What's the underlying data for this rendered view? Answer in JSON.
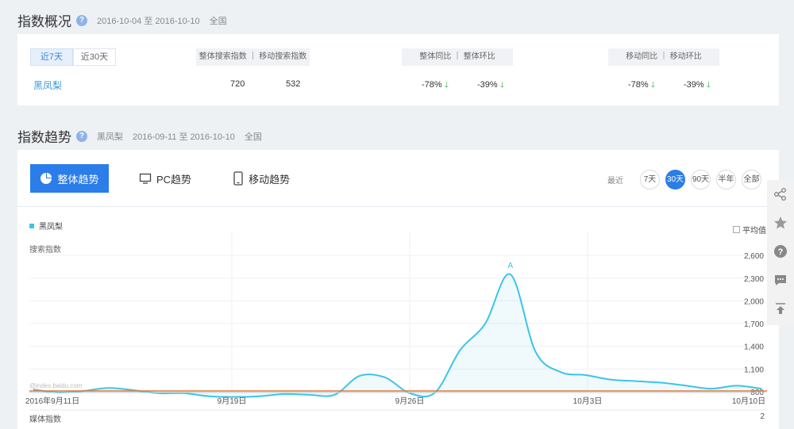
{
  "overview": {
    "title": "指数概况",
    "help": "?",
    "date_range": "2016-10-04 至 2016-10-10",
    "region": "全国",
    "tabs": [
      "近7天",
      "近30天"
    ],
    "keyword": "黑凤梨",
    "col_search": "整体搜索指数 ｜ 移动搜索指数",
    "col_overall": "整体同比 ｜ 整体环比",
    "col_mobile": "移动同比 ｜ 移动环比",
    "search_total": "720",
    "search_mobile": "532",
    "overall_yoy": "-78%",
    "overall_mom": "-39%",
    "mobile_yoy": "-78%",
    "mobile_mom": "-39%"
  },
  "trend": {
    "title": "指数趋势",
    "help": "?",
    "keyword": "黑凤梨",
    "date_range": "2016-09-11 至 2016-10-10",
    "region": "全国",
    "tabs": [
      "整体趋势",
      "PC趋势",
      "移动趋势"
    ],
    "period_label": "最近",
    "periods": [
      "7天",
      "30天",
      "90天",
      "半年",
      "全部"
    ],
    "legend": "黑凤梨",
    "avg_label": "平均值",
    "y_label": "搜索指数",
    "media_label": "媒体指数",
    "media_value": "2",
    "watermark": "@index.baidu.com"
  },
  "chart_data": {
    "type": "area",
    "ylabel": "搜索指数",
    "ylim": [
      800,
      2800
    ],
    "yticks": [
      "2,600",
      "2,300",
      "2,000",
      "1,700",
      "1,400",
      "1,100",
      "800"
    ],
    "ytick_values": [
      2600,
      2300,
      2000,
      1700,
      1400,
      1100,
      800
    ],
    "xticks": [
      "2016年9月11日",
      "9月19日",
      "9月26日",
      "10月3日",
      "10月10日"
    ],
    "xtick_index": [
      0,
      8,
      15,
      22,
      29
    ],
    "series": [
      {
        "name": "黑凤梨",
        "values": [
          830,
          790,
          810,
          850,
          820,
          780,
          780,
          740,
          730,
          740,
          770,
          760,
          760,
          1010,
          990,
          780,
          790,
          1350,
          1700,
          2350,
          1330,
          1060,
          1020,
          960,
          940,
          920,
          880,
          840,
          880,
          840
        ]
      }
    ],
    "average": 810,
    "annotation": "A",
    "annotation_index": 19,
    "line_color": "#3cc4e8",
    "avg_color": "#e07a3a"
  },
  "colors": {
    "accent": "#2b7de9",
    "link": "#3a9ad9",
    "down": "#2fb34a"
  }
}
